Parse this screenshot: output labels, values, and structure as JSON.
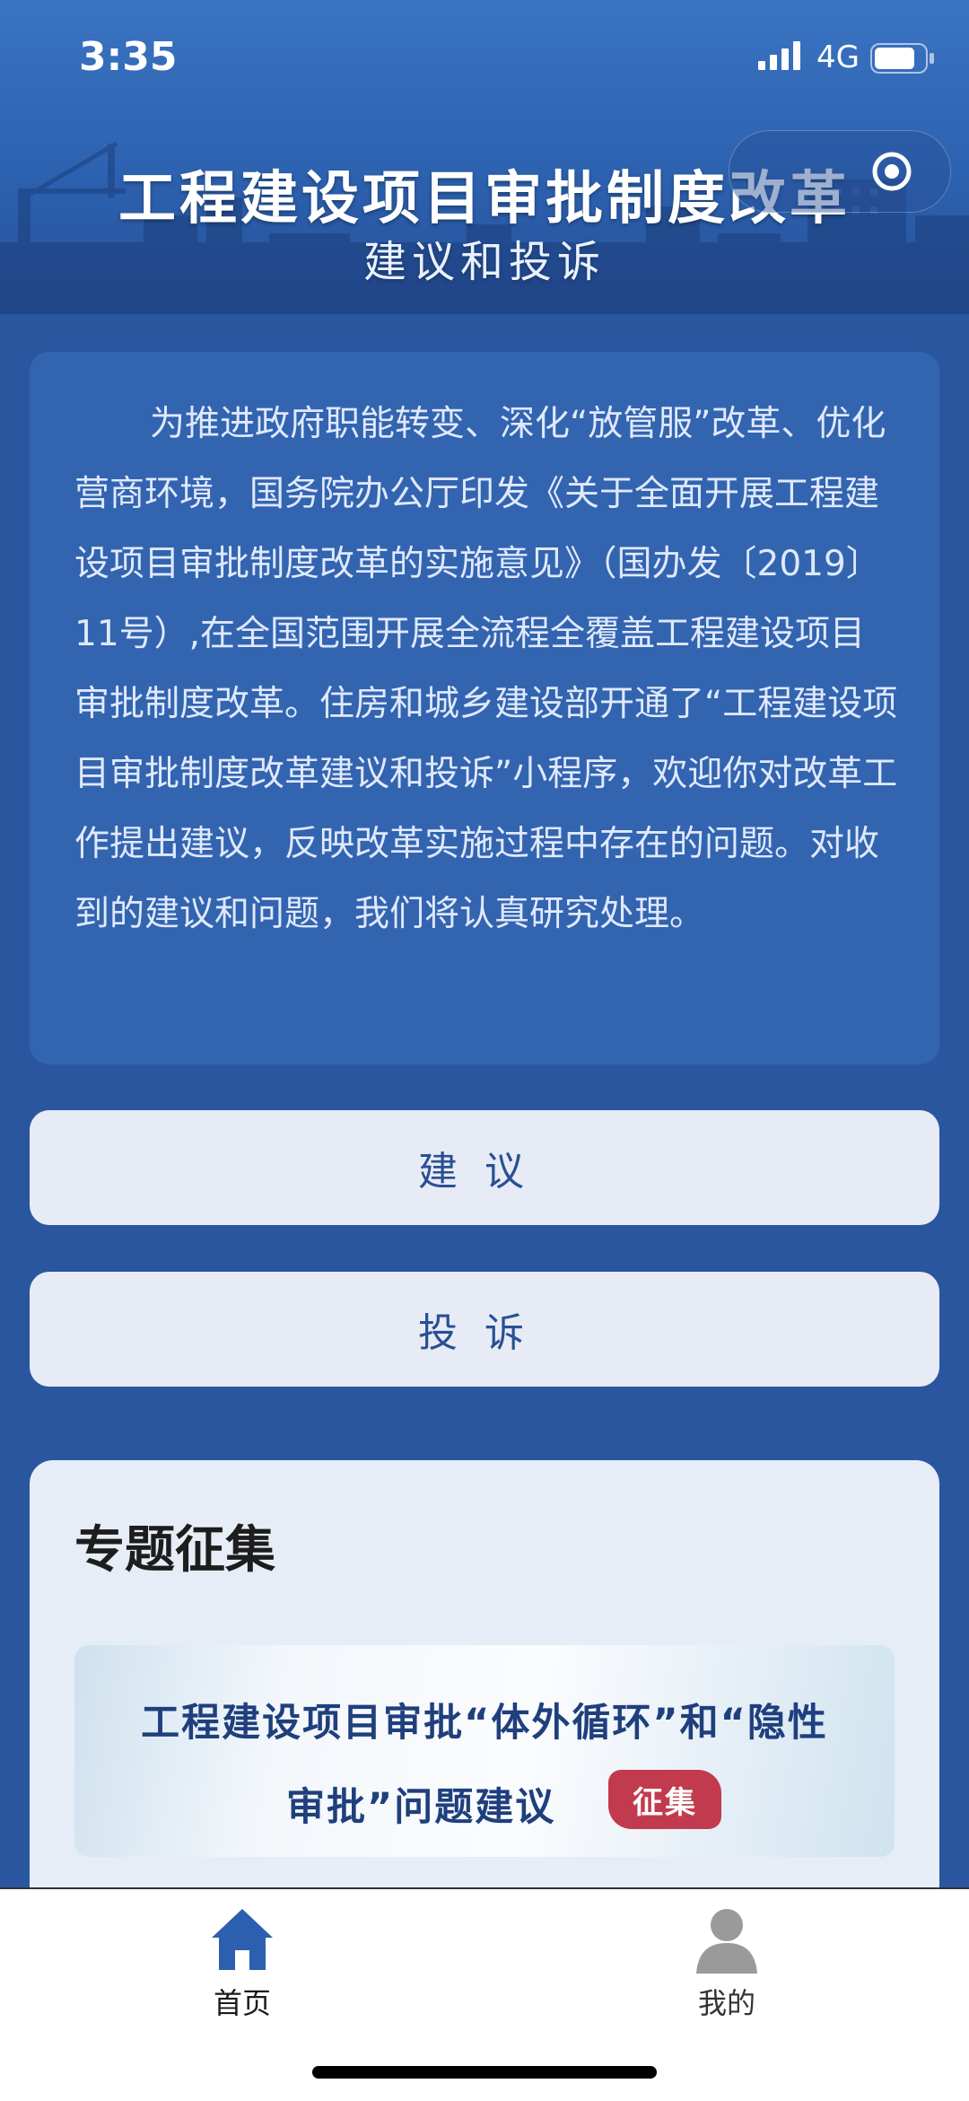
{
  "status_bar": {
    "time": "3:35",
    "network": "4G"
  },
  "header": {
    "title": "工程建设项目审批制度改革",
    "subtitle": "建议和投诉"
  },
  "intro": {
    "text": "为推进政府职能转变、深化“放管服”改革、优化营商环境，国务院办公厅印发《关于全面开展工程建设项目审批制度改革的实施意见》（国办发〔2019〕11号）,在全国范围开展全流程全覆盖工程建设项目审批制度改革。住房和城乡建设部开通了“工程建设项目审批制度改革建议和投诉”小程序，欢迎你对改革工作提出建议，反映改革实施过程中存在的问题。对收到的建议和问题，我们将认真研究处理。"
  },
  "buttons": {
    "suggest": "建议",
    "complain": "投诉"
  },
  "topic": {
    "title": "专题征集",
    "banner_line1": "工程建设项目审批“体外循环”和“隐性",
    "banner_line2": "审批”问题建议",
    "banner_tag": "征集"
  },
  "tabbar": {
    "items": [
      {
        "label": "首页",
        "icon": "home-icon",
        "active": true
      },
      {
        "label": "我的",
        "icon": "user-icon",
        "active": false
      }
    ]
  },
  "colors": {
    "background": "#2a56a0",
    "card": "#3364b0",
    "button": "#e6ebf5",
    "tag": "#c23a4d",
    "home_active": "#2c5fb0"
  }
}
